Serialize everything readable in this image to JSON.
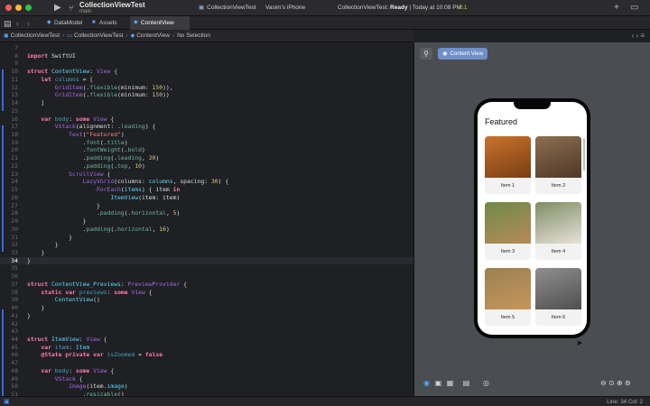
{
  "toolbar": {
    "project_title": "CollectionViewTest",
    "branch": "main",
    "scheme": "CollectionViewTest",
    "device": "Vasim's iPhone",
    "status_prefix": "CollectionViewTest: ",
    "status_state": "Ready",
    "status_suffix": " | Today at 10:08 PM",
    "warnings": "1",
    "run_icon": "play-icon",
    "branch_icon": "branch-icon"
  },
  "tabs": [
    {
      "label": "DataModel",
      "icon": "swift-file-icon"
    },
    {
      "label": "Assets",
      "icon": "asset-catalog-icon"
    },
    {
      "label": "ContentView",
      "icon": "swift-file-icon",
      "active": true
    }
  ],
  "breadcrumb": [
    "CollectionViewTest",
    "CollectionViewTest",
    "ContentView",
    "No Selection"
  ],
  "code_lines": [
    {
      "n": "7",
      "h": ""
    },
    {
      "n": "8",
      "h": "<span class='kw'>import</span> SwiftUI"
    },
    {
      "n": "9",
      "h": ""
    },
    {
      "n": "10",
      "h": "<span class='kw'>struct</span> <span class='ty'>ContentView</span>: <span class='pr'>View</span> {"
    },
    {
      "n": "11",
      "h": "    <span class='kw'>let</span> <span class='dc'>columns</span> = ["
    },
    {
      "n": "12",
      "h": "        <span class='pr'>GridItem</span>(.<span class='fn'>flexible</span>(minimum: <span class='nm'>150</span>)),"
    },
    {
      "n": "13",
      "h": "        <span class='pr'>GridItem</span>(.<span class='fn'>flexible</span>(minimum: <span class='nm'>150</span>))"
    },
    {
      "n": "14",
      "h": "    ]"
    },
    {
      "n": "15",
      "h": ""
    },
    {
      "n": "16",
      "h": "    <span class='kw'>var</span> <span class='dc'>body</span>: <span class='kw'>some</span> <span class='pr'>View</span> {"
    },
    {
      "n": "17",
      "h": "        <span class='pr'>VStack</span>(alignment: .<span class='fn'>leading</span>) {"
    },
    {
      "n": "18",
      "h": "            <span class='pr'>Text</span>(<span class='st'>\"Featured\"</span>)"
    },
    {
      "n": "19",
      "h": "                .<span class='fn'>font</span>(.<span class='fn'>title</span>)"
    },
    {
      "n": "20",
      "h": "                .<span class='fn'>fontWeight</span>(.<span class='fn'>bold</span>)"
    },
    {
      "n": "21",
      "h": "                .<span class='fn'>padding</span>(.<span class='fn'>leading</span>, <span class='nm'>20</span>)"
    },
    {
      "n": "22",
      "h": "                .<span class='fn'>padding</span>(.<span class='fn'>top</span>, <span class='nm'>10</span>)"
    },
    {
      "n": "23",
      "h": "            <span class='pr'>ScrollView</span> {"
    },
    {
      "n": "24",
      "h": "                <span class='pr'>LazyVGrid</span>(columns: <span class='ty'>columns</span>, spacing: <span class='nm'>30</span>) {"
    },
    {
      "n": "25",
      "h": "                    <span class='pr'>ForEach</span>(<span class='ty'>items</span>) { item <span class='kw'>in</span>"
    },
    {
      "n": "26",
      "h": "                        <span class='ty'>ItemView</span>(item: item)"
    },
    {
      "n": "27",
      "h": "                    }"
    },
    {
      "n": "28",
      "h": "                    .<span class='fn'>padding</span>(.<span class='fn'>horizontal</span>, <span class='nm'>5</span>)"
    },
    {
      "n": "29",
      "h": "                }"
    },
    {
      "n": "30",
      "h": "                .<span class='fn'>padding</span>(.<span class='fn'>horizontal</span>, <span class='nm'>16</span>)"
    },
    {
      "n": "31",
      "h": "            }"
    },
    {
      "n": "32",
      "h": "        }"
    },
    {
      "n": "33",
      "h": "    }"
    },
    {
      "n": "34",
      "h": "}",
      "cur": true
    },
    {
      "n": "35",
      "h": ""
    },
    {
      "n": "36",
      "h": ""
    },
    {
      "n": "37",
      "h": "<span class='kw'>struct</span> <span class='ty'>ContentView_Previews</span>: <span class='pr'>PreviewProvider</span> {"
    },
    {
      "n": "38",
      "h": "    <span class='kw'>static</span> <span class='kw'>var</span> <span class='dc'>previews</span>: <span class='kw'>some</span> <span class='pr'>View</span> {"
    },
    {
      "n": "39",
      "h": "        <span class='ty'>ContentView</span>()"
    },
    {
      "n": "40",
      "h": "    }"
    },
    {
      "n": "41",
      "h": "}"
    },
    {
      "n": "42",
      "h": ""
    },
    {
      "n": "43",
      "h": ""
    },
    {
      "n": "44",
      "h": "<span class='kw'>struct</span> <span class='ty'>ItemView</span>: <span class='pr'>View</span> {"
    },
    {
      "n": "45",
      "h": "    <span class='kw'>var</span> <span class='dc'>item</span>: <span class='ty'>Item</span>"
    },
    {
      "n": "46",
      "h": "    <span class='kw'>@State</span> <span class='kw'>private</span> <span class='kw'>var</span> <span class='dc'>isZoomed</span> = <span class='kw'>false</span>"
    },
    {
      "n": "47",
      "h": ""
    },
    {
      "n": "48",
      "h": "    <span class='kw'>var</span> <span class='dc'>body</span>: <span class='kw'>some</span> <span class='pr'>View</span> {"
    },
    {
      "n": "49",
      "h": "        <span class='pr'>VStack</span> {"
    },
    {
      "n": "50",
      "h": "            <span class='pr'>Image</span>(item.<span class='ty'>image</span>)"
    },
    {
      "n": "51",
      "h": "                .<span class='fn'>resizable</span>()"
    },
    {
      "n": "52",
      "h": "                .<span class='fn'>frame</span>(height: <span class='nm'>150</span>)"
    }
  ],
  "canvas": {
    "pin_icon": "pin-icon",
    "chip_label": "Content View",
    "preview": {
      "title": "Featured",
      "items": [
        {
          "label": "Item 1",
          "color_a": "#c8742e",
          "color_b": "#7a3d12"
        },
        {
          "label": "Item 2",
          "color_a": "#8e6e52",
          "color_b": "#4d3826"
        },
        {
          "label": "Item 3",
          "color_a": "#6f8a4a",
          "color_b": "#b78a56"
        },
        {
          "label": "Item 4",
          "color_a": "#7f8d64",
          "color_b": "#e7e2da"
        },
        {
          "label": "Item 5",
          "color_a": "#9a8152",
          "color_b": "#c6965a"
        },
        {
          "label": "Item 6",
          "color_a": "#8f8f8f",
          "color_b": "#4f4f4f"
        }
      ]
    }
  },
  "statusbar": {
    "left_icon": "debug-area-icon",
    "position": "Line: 34  Col: 2"
  }
}
